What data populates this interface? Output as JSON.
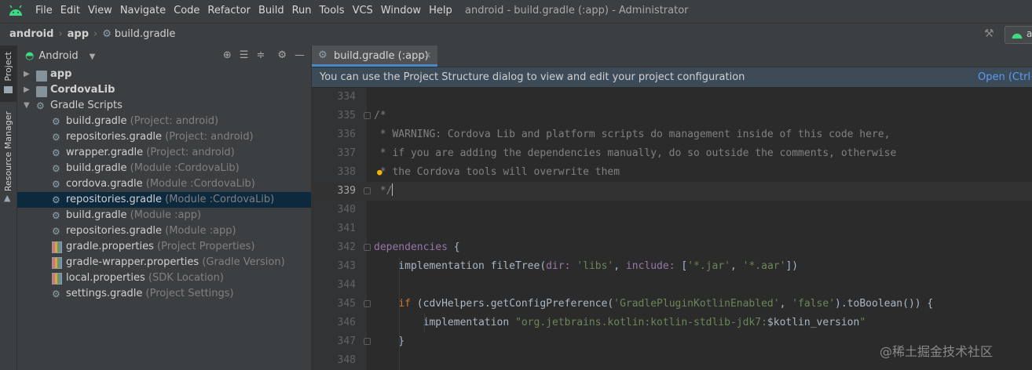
{
  "window": {
    "title": "android - build.gradle (:app) - Administrator",
    "menu": [
      "File",
      "Edit",
      "View",
      "Navigate",
      "Code",
      "Refactor",
      "Build",
      "Run",
      "Tools",
      "VCS",
      "Window",
      "Help"
    ]
  },
  "breadcrumb": {
    "items": [
      "android",
      "app",
      "build.gradle"
    ],
    "run_config_label": "a"
  },
  "toolstrip": {
    "project_tab": "Project",
    "resource_tab": "Resource Manager"
  },
  "project_panel": {
    "view_selector": "Android",
    "tree": [
      {
        "label": "app",
        "hint": "",
        "depth": 0,
        "arrow": "right",
        "icon": "folder-icon",
        "bold": true,
        "selected": false
      },
      {
        "label": "CordovaLib",
        "hint": "",
        "depth": 0,
        "arrow": "right",
        "icon": "folder-icon",
        "bold": true,
        "selected": false
      },
      {
        "label": "Gradle Scripts",
        "hint": "",
        "depth": 0,
        "arrow": "down",
        "icon": "gradle-icon",
        "bold": false,
        "selected": false
      },
      {
        "label": "build.gradle",
        "hint": "(Project: android)",
        "depth": 1,
        "arrow": "",
        "icon": "gradle-icon",
        "bold": false,
        "selected": false
      },
      {
        "label": "repositories.gradle",
        "hint": "(Project: android)",
        "depth": 1,
        "arrow": "",
        "icon": "gradle-icon",
        "bold": false,
        "selected": false
      },
      {
        "label": "wrapper.gradle",
        "hint": "(Project: android)",
        "depth": 1,
        "arrow": "",
        "icon": "gradle-icon",
        "bold": false,
        "selected": false
      },
      {
        "label": "build.gradle",
        "hint": "(Module :CordovaLib)",
        "depth": 1,
        "arrow": "",
        "icon": "gradle-icon",
        "bold": false,
        "selected": false
      },
      {
        "label": "cordova.gradle",
        "hint": "(Module :CordovaLib)",
        "depth": 1,
        "arrow": "",
        "icon": "gradle-icon",
        "bold": false,
        "selected": false
      },
      {
        "label": "repositories.gradle",
        "hint": "(Module :CordovaLib)",
        "depth": 1,
        "arrow": "",
        "icon": "gradle-icon",
        "bold": false,
        "selected": true
      },
      {
        "label": "build.gradle",
        "hint": "(Module :app)",
        "depth": 1,
        "arrow": "",
        "icon": "gradle-icon",
        "bold": false,
        "selected": false
      },
      {
        "label": "repositories.gradle",
        "hint": "(Module :app)",
        "depth": 1,
        "arrow": "",
        "icon": "gradle-icon",
        "bold": false,
        "selected": false
      },
      {
        "label": "gradle.properties",
        "hint": "(Project Properties)",
        "depth": 1,
        "arrow": "",
        "icon": "properties-icon",
        "bold": false,
        "selected": false
      },
      {
        "label": "gradle-wrapper.properties",
        "hint": "(Gradle Version)",
        "depth": 1,
        "arrow": "",
        "icon": "properties-icon",
        "bold": false,
        "selected": false
      },
      {
        "label": "local.properties",
        "hint": "(SDK Location)",
        "depth": 1,
        "arrow": "",
        "icon": "properties-icon",
        "bold": false,
        "selected": false
      },
      {
        "label": "settings.gradle",
        "hint": "(Project Settings)",
        "depth": 1,
        "arrow": "",
        "icon": "gradle-icon",
        "bold": false,
        "selected": false
      }
    ]
  },
  "editor": {
    "tab_label": "build.gradle (:app)",
    "banner_message": "You can use the Project Structure dialog to view and edit your project configuration",
    "banner_link": "Open (Ctrl+",
    "lines": [
      {
        "n": "334",
        "tokens": []
      },
      {
        "n": "335",
        "fold": true,
        "tokens": [
          {
            "t": "/*",
            "c": "c"
          }
        ]
      },
      {
        "n": "336",
        "tokens": [
          {
            "t": " * WARNING: Cordova Lib and platform scripts do management inside of this code here,",
            "c": "c"
          }
        ]
      },
      {
        "n": "337",
        "tokens": [
          {
            "t": " * if you are adding the dependencies manually, do so outside the comments, otherwise",
            "c": "c"
          }
        ]
      },
      {
        "n": "338",
        "bulb": true,
        "tokens": [
          {
            "t": " * the Cordova tools will overwrite them",
            "c": "c"
          }
        ]
      },
      {
        "n": "339",
        "fold": true,
        "current": true,
        "caret": true,
        "tokens": [
          {
            "t": " */",
            "c": "c"
          }
        ]
      },
      {
        "n": "340",
        "tokens": []
      },
      {
        "n": "341",
        "tokens": []
      },
      {
        "n": "342",
        "fold": true,
        "tokens": [
          {
            "t": "dependencies",
            "c": "p"
          },
          {
            "t": " {",
            "c": "d"
          }
        ]
      },
      {
        "n": "343",
        "tokens": [
          {
            "t": "    implementation fileTree(",
            "c": "d"
          },
          {
            "t": "dir:",
            "c": "p"
          },
          {
            "t": " ",
            "c": "d"
          },
          {
            "t": "'libs'",
            "c": "s"
          },
          {
            "t": ", ",
            "c": "d"
          },
          {
            "t": "include:",
            "c": "p"
          },
          {
            "t": " [",
            "c": "d"
          },
          {
            "t": "'*.jar'",
            "c": "s"
          },
          {
            "t": ", ",
            "c": "d"
          },
          {
            "t": "'*.aar'",
            "c": "s"
          },
          {
            "t": "])",
            "c": "d"
          }
        ]
      },
      {
        "n": "344",
        "tokens": []
      },
      {
        "n": "345",
        "fold": true,
        "tokens": [
          {
            "t": "    ",
            "c": "d"
          },
          {
            "t": "if",
            "c": "k"
          },
          {
            "t": " (cdvHelpers.getConfigPreference(",
            "c": "d"
          },
          {
            "t": "'GradlePluginKotlinEnabled'",
            "c": "s"
          },
          {
            "t": ", ",
            "c": "d"
          },
          {
            "t": "'false'",
            "c": "s"
          },
          {
            "t": ").toBoolean()) {",
            "c": "d"
          }
        ]
      },
      {
        "n": "346",
        "tokens": [
          {
            "t": "        implementation ",
            "c": "d"
          },
          {
            "t": "\"org.jetbrains.kotlin:kotlin-stdlib-jdk7:",
            "c": "s"
          },
          {
            "t": "$kotlin_version",
            "c": "d"
          },
          {
            "t": "\"",
            "c": "s"
          }
        ]
      },
      {
        "n": "347",
        "fold": true,
        "tokens": [
          {
            "t": "    }",
            "c": "d"
          }
        ]
      },
      {
        "n": "348",
        "tokens": []
      }
    ]
  },
  "watermark": "@稀土掘金技术社区",
  "colors": {
    "accent": "#4a88c7",
    "selection": "#0d293e",
    "banner": "#3d4a57",
    "link": "#589df6"
  }
}
